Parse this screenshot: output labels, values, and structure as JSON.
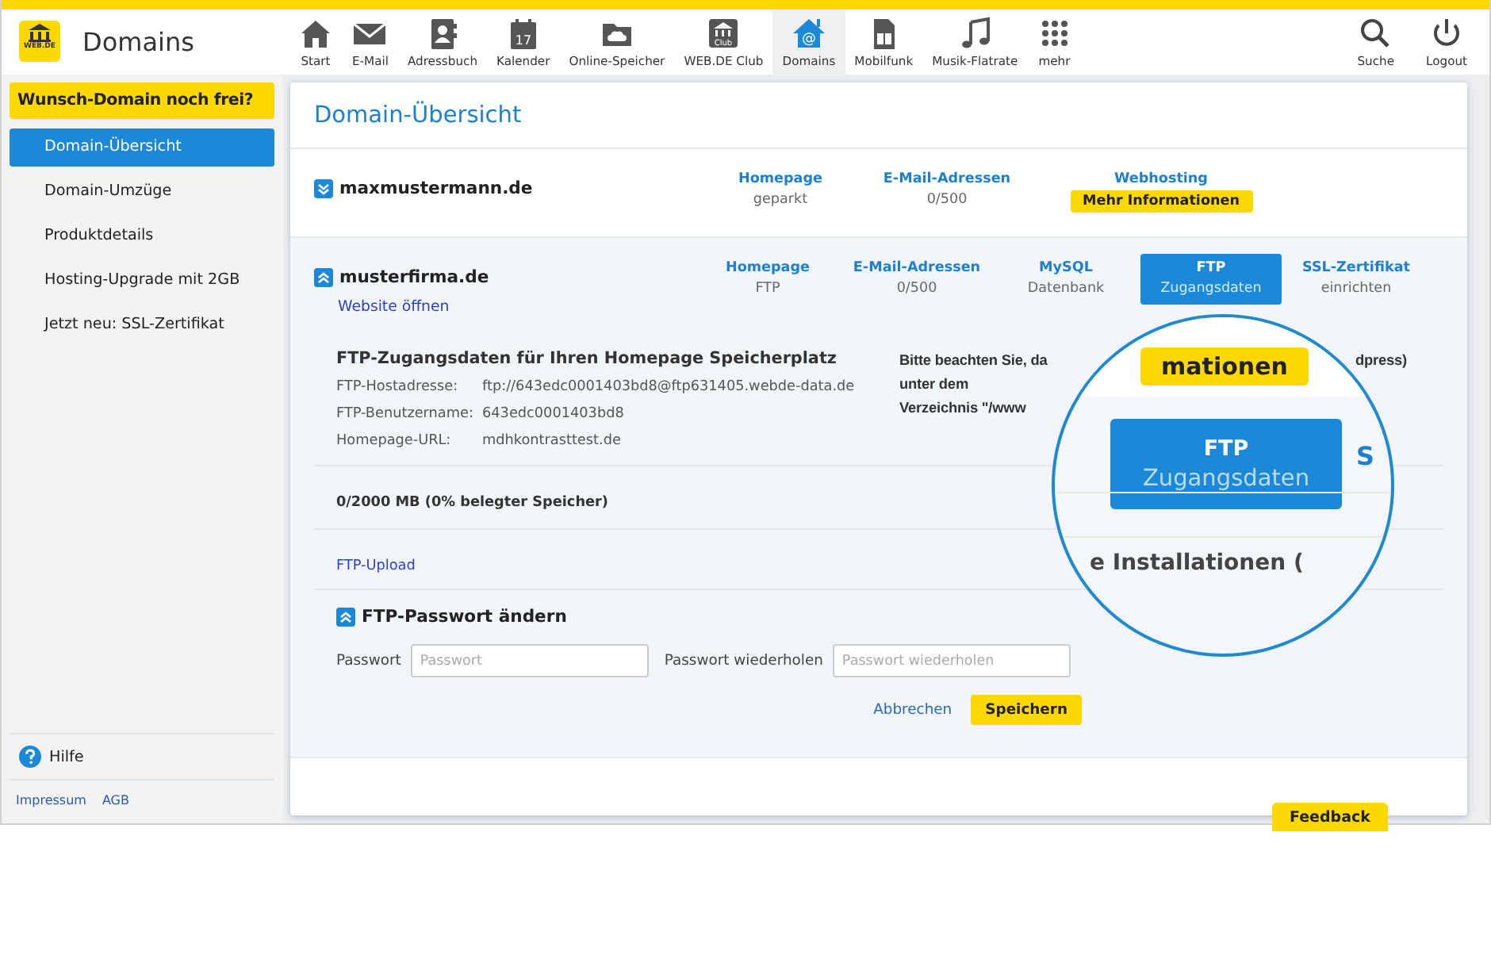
{
  "header": {
    "logo_text": "WEB.DE",
    "title": "Domains",
    "nav": [
      {
        "label": "Start",
        "selected": false
      },
      {
        "label": "E-Mail",
        "selected": false
      },
      {
        "label": "Adressbuch",
        "selected": false
      },
      {
        "label": "Kalender",
        "selected": false,
        "icon_text": "17"
      },
      {
        "label": "Online-Speicher",
        "selected": false
      },
      {
        "label": "WEB.DE Club",
        "selected": false,
        "icon_text": "Club"
      },
      {
        "label": "Domains",
        "selected": true,
        "icon_text": "@"
      },
      {
        "label": "Mobilfunk",
        "selected": false
      },
      {
        "label": "Musik-Flatrate",
        "selected": false
      },
      {
        "label": "mehr",
        "selected": false
      }
    ],
    "actions": [
      {
        "label": "Suche"
      },
      {
        "label": "Logout"
      }
    ]
  },
  "sidebar": {
    "promo": "Wunsch-Domain noch frei?",
    "items": [
      {
        "label": "Domain-Übersicht",
        "selected": true
      },
      {
        "label": "Domain-Umzüge",
        "selected": false
      },
      {
        "label": "Produktdetails",
        "selected": false
      },
      {
        "label": "Hosting-Upgrade mit 2GB",
        "selected": false
      },
      {
        "label": "Jetzt neu: SSL-Zertifikat",
        "selected": false
      }
    ],
    "help": "Hilfe",
    "footer_links": [
      "Impressum",
      "AGB"
    ]
  },
  "main": {
    "title": "Domain-Übersicht",
    "domains": [
      {
        "name": "maxmustermann.de",
        "expanded": false,
        "columns": [
          {
            "title": "Homepage",
            "value": "geparkt"
          },
          {
            "title": "E-Mail-Adressen",
            "value": "0/500"
          },
          {
            "title": "Webhosting",
            "button": "Mehr Informationen"
          }
        ]
      },
      {
        "name": "musterfirma.de",
        "expanded": true,
        "link": "Website öffnen",
        "columns": [
          {
            "title": "Homepage",
            "value": "FTP",
            "selected": false
          },
          {
            "title": "E-Mail-Adressen",
            "value": "0/500",
            "selected": false
          },
          {
            "title": "MySQL",
            "value": "Datenbank",
            "selected": false
          },
          {
            "title": "FTP",
            "value": "Zugangsdaten",
            "selected": true
          },
          {
            "title": "SSL-Zertifikat",
            "value": "einrichten",
            "selected": false
          }
        ],
        "details": {
          "heading": "FTP-Zugangsdaten für Ihren Homepage Speicherplatz",
          "rows": [
            {
              "label": "FTP-Hostadresse:",
              "value": "ftp://643edc0001403bd8@ftp631405.webde-data.de"
            },
            {
              "label": "FTP-Benutzername:",
              "value": "643edc0001403bd8"
            },
            {
              "label": "Homepage-URL:",
              "value": "mdhkontrasttest.de"
            }
          ],
          "notice": {
            "line1_start": "Bitte beachten Sie, da",
            "line1_end": "dpress)",
            "lines": [
              "unter dem",
              "Verzeichnis \"/www"
            ]
          },
          "storage": "0/2000 MB (0% belegter Speicher)",
          "upload_link": "FTP-Upload",
          "password": {
            "title": "FTP-Passwort ändern",
            "expanded": true,
            "fields": [
              {
                "label": "Passwort",
                "placeholder": "Passwort"
              },
              {
                "label": "Passwort wiederholen",
                "placeholder": "Passwort wiederholen"
              }
            ],
            "cancel": "Abbrechen",
            "save": "Speichern"
          }
        }
      }
    ]
  },
  "magnifier": {
    "button_fragment": "mationen",
    "tab": {
      "title": "FTP",
      "subtitle": "Zugangsdaten"
    },
    "fragment": "S",
    "heading_fragment": "e Installationen ("
  },
  "feedback": "Feedback"
}
